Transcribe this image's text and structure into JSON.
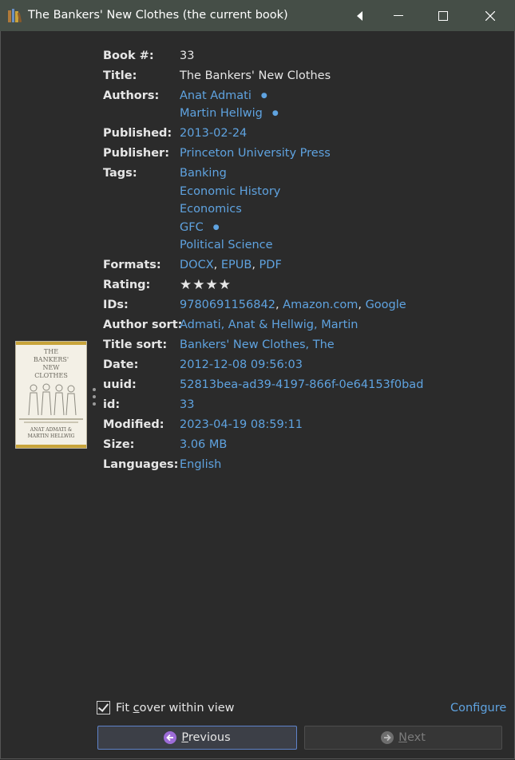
{
  "window": {
    "title": "The Bankers' New Clothes (the current book)"
  },
  "fields": [
    {
      "label": "Book #:",
      "values": [
        "33"
      ],
      "link": false
    },
    {
      "label": "Title:",
      "values": [
        "The Bankers' New Clothes"
      ],
      "link": false
    },
    {
      "label": "Authors:",
      "values": [
        "Anat Admati",
        "Martin Hellwig"
      ],
      "link": true
    },
    {
      "label": "Published:",
      "values": [
        "2013-02-24"
      ],
      "link": true
    },
    {
      "label": "Publisher:",
      "values": [
        "Princeton University Press"
      ],
      "link": true
    },
    {
      "label": "Tags:",
      "values": [
        "Banking",
        "Economic History",
        "Economics",
        "GFC",
        "Political Science"
      ],
      "link": true
    },
    {
      "label": "Formats:",
      "values": [
        "DOCX",
        "EPUB",
        "PDF"
      ],
      "link": true
    },
    {
      "label": "Rating:",
      "values": [
        "★★★★"
      ],
      "rating": 4
    },
    {
      "label": "IDs:",
      "values": [
        "9780691156842",
        "Amazon.com",
        "Google"
      ],
      "link": true
    },
    {
      "label": "Author sort:",
      "values": [
        "Admati, Anat & Hellwig, Martin"
      ],
      "link": true
    },
    {
      "label": "Title sort:",
      "values": [
        "Bankers' New Clothes, The"
      ],
      "link": true
    },
    {
      "label": "Date:",
      "values": [
        "2012-12-08 09:56:03"
      ],
      "link": true
    },
    {
      "label": "uuid:",
      "values": [
        "52813bea-ad39-4197-866f-0e64153f0bad"
      ],
      "link": true
    },
    {
      "label": "id:",
      "values": [
        "33"
      ],
      "link": true
    },
    {
      "label": "Modified:",
      "values": [
        "2023-04-19 08:59:11"
      ],
      "link": true
    },
    {
      "label": "Size:",
      "values": [
        "3.06 MB"
      ],
      "link": true
    },
    {
      "label": "Languages:",
      "values": [
        "English"
      ],
      "link": true
    }
  ],
  "cover": {
    "title_line1": "THE",
    "title_line2": "BANKERS'",
    "title_line3": "NEW",
    "title_line4": "CLOTHES",
    "author_line1": "ANAT ADMATI &",
    "author_line2": "MARTIN HELLWIG"
  },
  "footer": {
    "fit_cover_label_pre": "Fit ",
    "fit_cover_label_u": "c",
    "fit_cover_label_post": "over within view",
    "fit_cover_checked": true,
    "configure_label": "Configure",
    "prev_label_u": "P",
    "prev_label_rest": "revious",
    "next_label_u": "N",
    "next_label_rest": "ext"
  },
  "colors": {
    "link": "#5fa3e0",
    "titlebar": "#454e47",
    "background": "#2b2b2b"
  }
}
